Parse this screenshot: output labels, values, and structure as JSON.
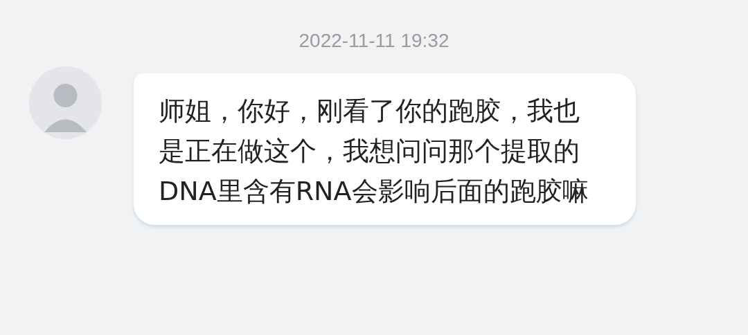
{
  "messages": [
    {
      "time": "2022-11-11 19:32",
      "text": "师姐，你好，刚看了你的跑胶，我也是正在做这个，我想问问那个提取的DNA里含有RNA会影响后面的跑胶嘛"
    }
  ]
}
